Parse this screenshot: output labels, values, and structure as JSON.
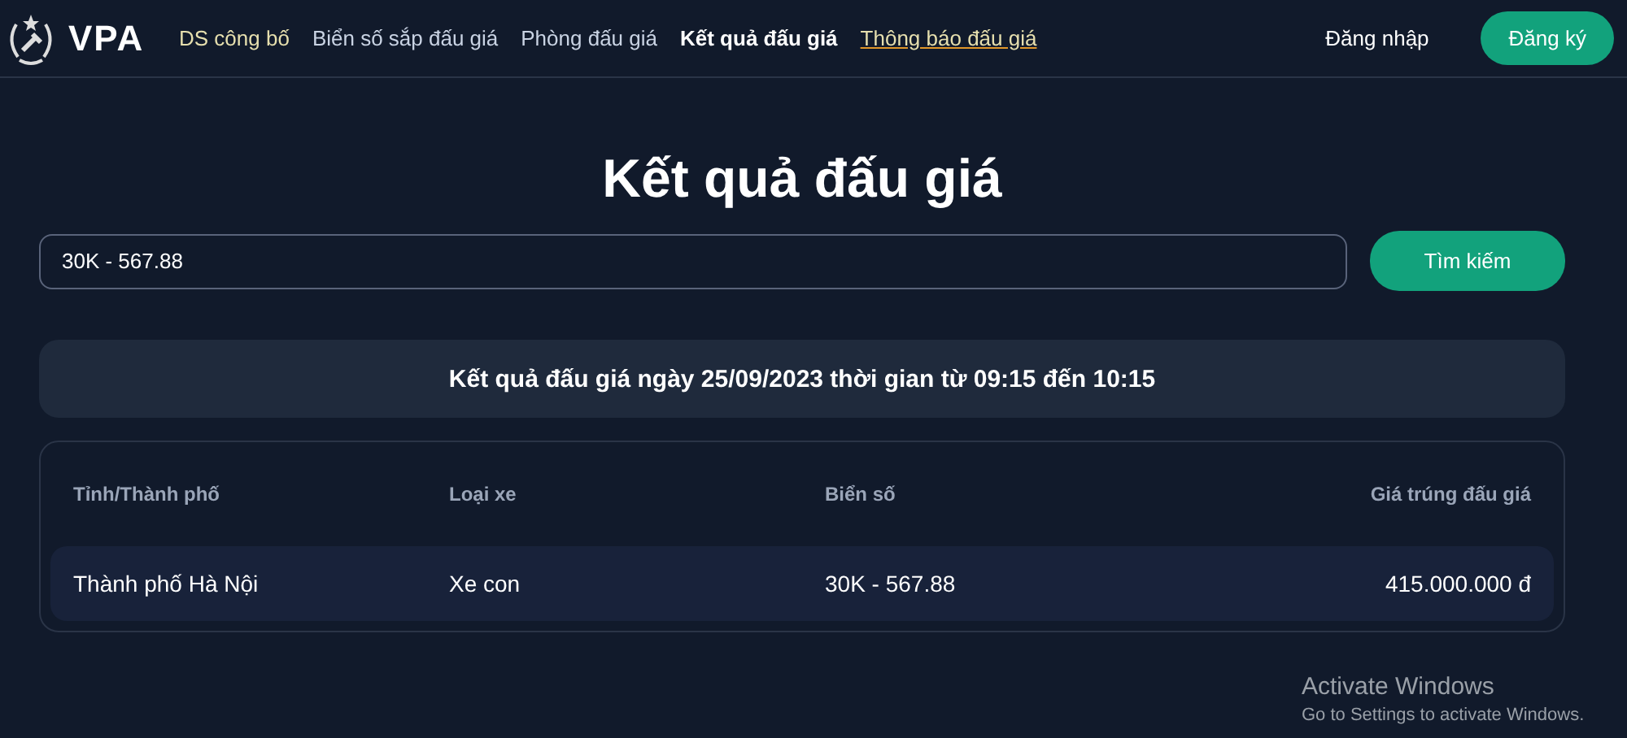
{
  "header": {
    "logo_text": "VPA",
    "nav": [
      {
        "label": "DS công bố",
        "selected": false,
        "underlined": false,
        "color": "#e6dfae"
      },
      {
        "label": "Biển số sắp đấu giá",
        "selected": false,
        "underlined": false,
        "color": "#c9d3e3"
      },
      {
        "label": "Phòng đấu giá",
        "selected": false,
        "underlined": false,
        "color": "#c9d3e3"
      },
      {
        "label": "Kết quả đấu giá",
        "selected": true,
        "underlined": false,
        "color": "#ffffff"
      },
      {
        "label": "Thông báo đấu giá",
        "selected": false,
        "underlined": true,
        "color": "#e6dfae"
      }
    ],
    "login": "Đăng nhập",
    "register": "Đăng ký"
  },
  "page_title": "Kết quả đấu giá",
  "search": {
    "value": "30K - 567.88",
    "button": "Tìm kiếm"
  },
  "result_banner": "Kết quả đấu giá ngày 25/09/2023 thời gian từ 09:15 đến 10:15",
  "table": {
    "columns": [
      "Tỉnh/Thành phố",
      "Loại xe",
      "Biển số",
      "Giá trúng đấu giá"
    ],
    "rows": [
      [
        "Thành phố Hà Nội",
        "Xe con",
        "30K - 567.88",
        "415.000.000 đ"
      ]
    ]
  },
  "os_notice": {
    "title": "Activate Windows",
    "text": "Go to Settings to activate Windows."
  }
}
